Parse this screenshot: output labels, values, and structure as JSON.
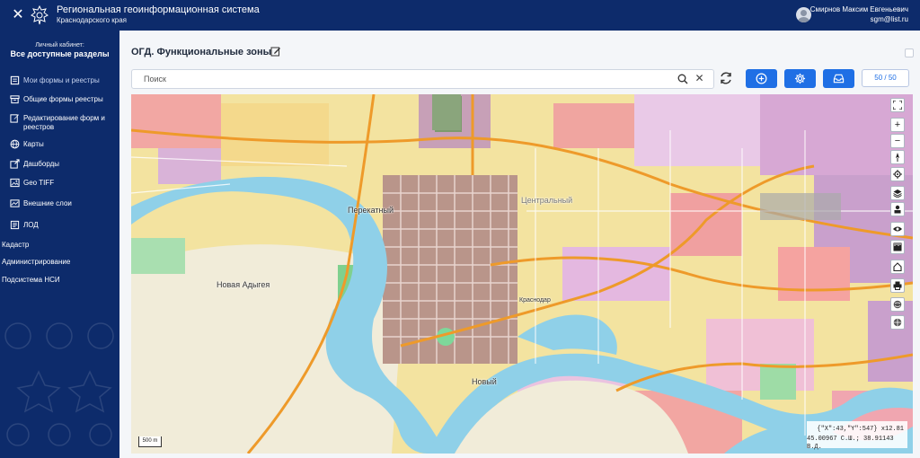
{
  "header": {
    "close_glyph": "✕",
    "system_title": "Региональная геоинформационная система",
    "system_subtitle": "Краснодарского края",
    "user_name": "Смирнов Максим Евгеньевич",
    "user_email": "sgm@list.ru"
  },
  "sidebar": {
    "cabinet_label": "Личный кабинет:",
    "cabinet_title": "Все доступные разделы",
    "items": [
      {
        "label": "Мои формы и реестры",
        "icon": "forms-icon",
        "active": true
      },
      {
        "label": "Общие формы реестры",
        "icon": "archive-icon"
      },
      {
        "label": "Редактирование форм и реестров",
        "icon": "edit-icon"
      },
      {
        "label": "Карты",
        "icon": "globe-icon"
      },
      {
        "label": "Дашборды",
        "icon": "external-link-icon"
      },
      {
        "label": "Geo TIFF",
        "icon": "image-icon"
      },
      {
        "label": "Внешние слои",
        "icon": "layers-icon"
      },
      {
        "label": "ЛОД",
        "icon": "document-icon"
      },
      {
        "label": "Кадастр"
      },
      {
        "label": "Администрирование"
      },
      {
        "label": "Подсистема НСИ"
      }
    ]
  },
  "main": {
    "title": "ОГД. Функциональные зоны",
    "search_placeholder": "Поиск",
    "clear_glyph": "✕",
    "counter": "50 / 50"
  },
  "map": {
    "labels": {
      "perekatny": "Перекатный",
      "novaya_adygeya": "Новая Адыгея",
      "noviy": "Новый",
      "centralny": "Центральный",
      "krasnodar": "Краснодар"
    },
    "coords_line1": "{\"X\":43,\"Y\":547} x12.81",
    "coords_line2": "45.00967 С.Ш.; 38.91143 В.Д.",
    "scale": "500 m",
    "tools": {
      "zoom_in": "+",
      "zoom_out": "−"
    }
  },
  "colors": {
    "header_bg": "#0d2b6b",
    "accent": "#1f6fe5",
    "river": "#8fd0e8"
  }
}
